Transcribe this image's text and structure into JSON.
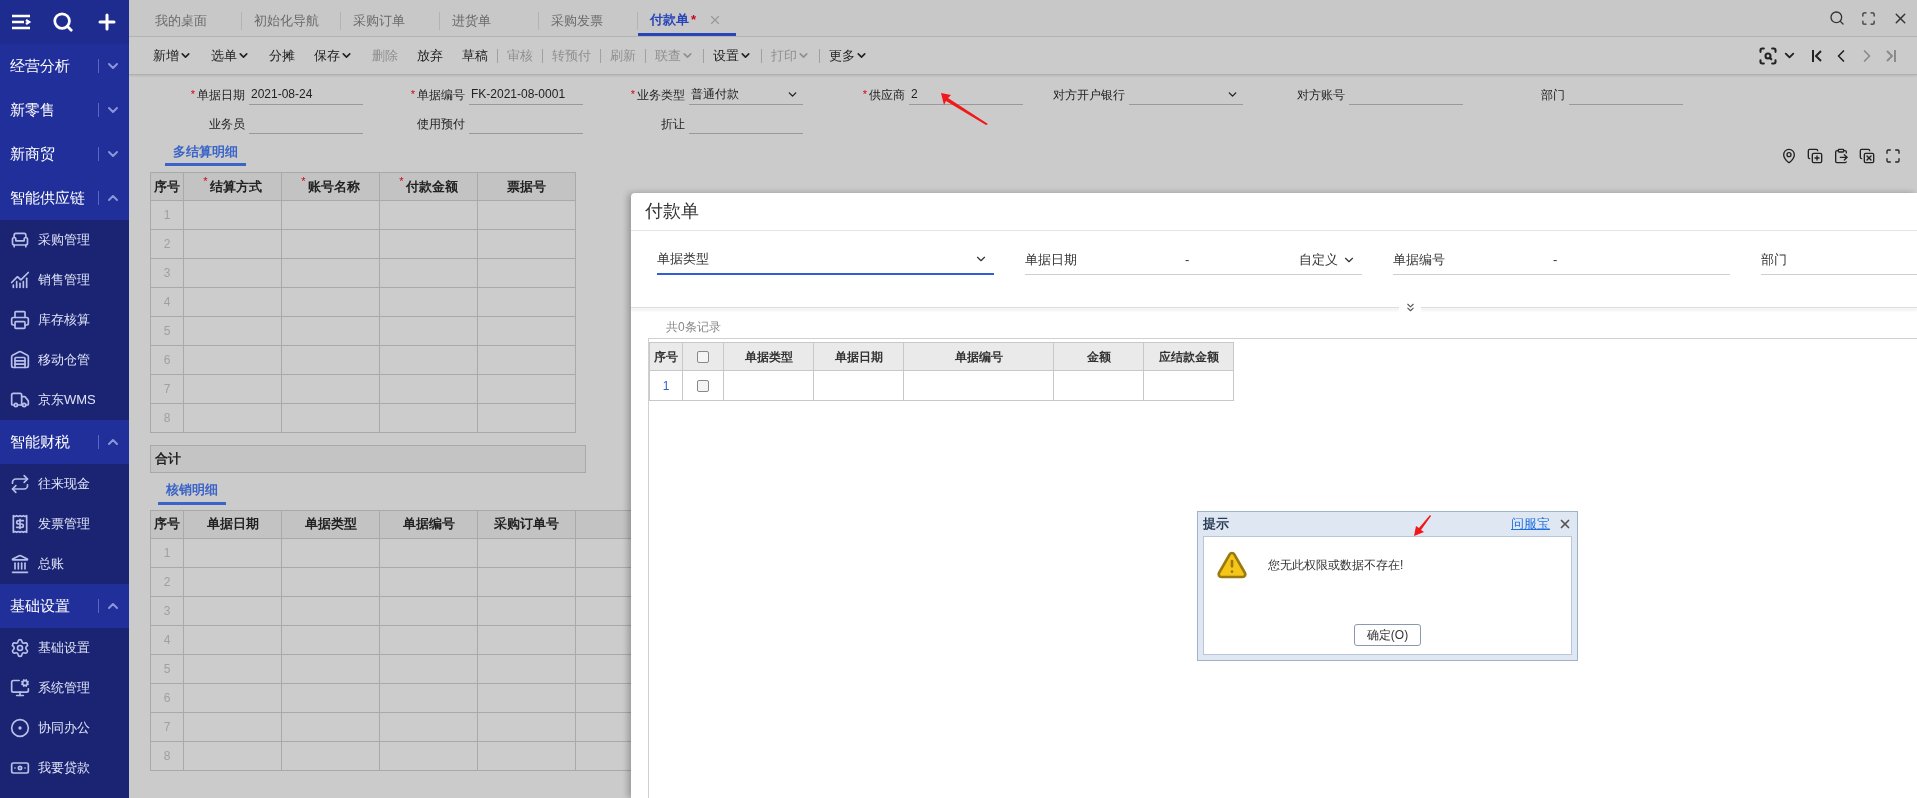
{
  "sidebar": {
    "groups": [
      {
        "label": "经营分析",
        "expanded": false
      },
      {
        "label": "新零售",
        "expanded": false
      },
      {
        "label": "新商贸",
        "expanded": false
      },
      {
        "label": "智能供应链",
        "expanded": true,
        "children": [
          {
            "label": "采购管理"
          },
          {
            "label": "销售管理"
          },
          {
            "label": "库存核算"
          },
          {
            "label": "移动仓管"
          },
          {
            "label": "京东WMS"
          }
        ]
      },
      {
        "label": "智能财税",
        "expanded": true,
        "children": [
          {
            "label": "往来现金"
          },
          {
            "label": "发票管理"
          },
          {
            "label": "总账"
          }
        ]
      },
      {
        "label": "基础设置",
        "expanded": true,
        "children": [
          {
            "label": "基础设置"
          },
          {
            "label": "系统管理"
          },
          {
            "label": "协同办公"
          },
          {
            "label": "我要贷款"
          }
        ]
      }
    ]
  },
  "tabs": [
    {
      "label": "我的桌面",
      "selected": false,
      "closable": false
    },
    {
      "label": "初始化导航",
      "selected": false,
      "closable": false
    },
    {
      "label": "采购订单",
      "selected": false,
      "closable": false
    },
    {
      "label": "进货单",
      "selected": false,
      "closable": false
    },
    {
      "label": "采购发票",
      "selected": false,
      "closable": false
    },
    {
      "label": "付款单",
      "selected": true,
      "dirty_mark": "*",
      "closable": true
    }
  ],
  "toolbar": [
    {
      "label": "新增",
      "dropdown": true,
      "disabled": false,
      "divider_before": false
    },
    {
      "label": "选单",
      "dropdown": true,
      "disabled": false,
      "divider_before": false
    },
    {
      "label": "分摊",
      "dropdown": false,
      "disabled": false,
      "divider_before": false
    },
    {
      "label": "保存",
      "dropdown": true,
      "disabled": false,
      "divider_before": false
    },
    {
      "label": "删除",
      "dropdown": false,
      "disabled": true,
      "divider_before": false
    },
    {
      "label": "放弃",
      "dropdown": false,
      "disabled": false,
      "divider_before": false
    },
    {
      "label": "草稿",
      "dropdown": false,
      "disabled": false,
      "divider_before": false
    },
    {
      "label": "审核",
      "dropdown": false,
      "disabled": true,
      "divider_before": true
    },
    {
      "label": "转预付",
      "dropdown": false,
      "disabled": true,
      "divider_before": true
    },
    {
      "label": "刷新",
      "dropdown": false,
      "disabled": true,
      "divider_before": true
    },
    {
      "label": "联查",
      "dropdown": true,
      "disabled": true,
      "divider_before": true
    },
    {
      "label": "设置",
      "dropdown": true,
      "disabled": false,
      "divider_before": true
    },
    {
      "label": "打印",
      "dropdown": true,
      "disabled": true,
      "divider_before": true
    },
    {
      "label": "更多",
      "dropdown": true,
      "disabled": false,
      "divider_before": true
    }
  ],
  "form": {
    "rows": [
      [
        {
          "label": "单据日期",
          "required_mark": "*",
          "value": "2021-08-24",
          "kind": "text"
        },
        {
          "label": "单据编号",
          "required_mark": "*",
          "value": "FK-2021-08-0001",
          "kind": "text"
        },
        {
          "label": "业务类型",
          "required_mark": "*",
          "value": "普通付款",
          "kind": "select"
        },
        {
          "label": "供应商",
          "required_mark": "*",
          "value": "2",
          "kind": "text"
        },
        {
          "label": "对方开户银行",
          "kind": "select"
        },
        {
          "label": "对方账号",
          "kind": "text"
        },
        {
          "label": "部门",
          "kind": "text"
        }
      ],
      [
        {
          "label": "业务员",
          "kind": "text"
        },
        {
          "label": "使用预付",
          "kind": "text"
        },
        {
          "label": "折让",
          "kind": "text"
        }
      ]
    ]
  },
  "settlement": {
    "tab": "多结算明细",
    "columns": [
      {
        "label": "序号"
      },
      {
        "label": "结算方式",
        "required_mark": "*"
      },
      {
        "label": "账号名称",
        "required_mark": "*"
      },
      {
        "label": "付款金额",
        "required_mark": "*"
      },
      {
        "label": "票据号"
      }
    ],
    "rows": [
      "1",
      "2",
      "3",
      "4",
      "5",
      "6",
      "7",
      "8"
    ],
    "total_label": "合计"
  },
  "writeoff": {
    "tab": "核销明细",
    "columns": [
      {
        "label": "序号"
      },
      {
        "label": "单据日期"
      },
      {
        "label": "单据类型"
      },
      {
        "label": "单据编号"
      },
      {
        "label": "采购订单号"
      }
    ],
    "rows": [
      "1",
      "2",
      "3",
      "4",
      "5",
      "6",
      "7",
      "8"
    ]
  },
  "panel": {
    "title": "付款单",
    "filters": [
      {
        "label": "单据类型",
        "kind": "select",
        "focused": true
      },
      {
        "label": "单据日期",
        "kind": "range",
        "separator": "-",
        "option": "自定义",
        "focused": false
      },
      {
        "label": "单据编号",
        "kind": "range",
        "separator": "-",
        "focused": false
      },
      {
        "label": "部门",
        "kind": "text",
        "focused": false
      }
    ],
    "record_count": "共0条记录",
    "table": {
      "columns": [
        {
          "label": "序号",
          "kind": "text"
        },
        {
          "kind": "checkbox",
          "checked": false
        },
        {
          "label": "单据类型",
          "kind": "text"
        },
        {
          "label": "单据日期",
          "kind": "text"
        },
        {
          "label": "单据编号",
          "kind": "text"
        },
        {
          "label": "金额",
          "kind": "text"
        },
        {
          "label": "应结款金额",
          "kind": "text"
        }
      ],
      "rows": [
        {
          "index": "1",
          "checked": false
        }
      ]
    }
  },
  "dialog": {
    "title": "提示",
    "link": "问服宝",
    "message": "您无此权限或数据不存在!",
    "button": "确定(O)"
  }
}
